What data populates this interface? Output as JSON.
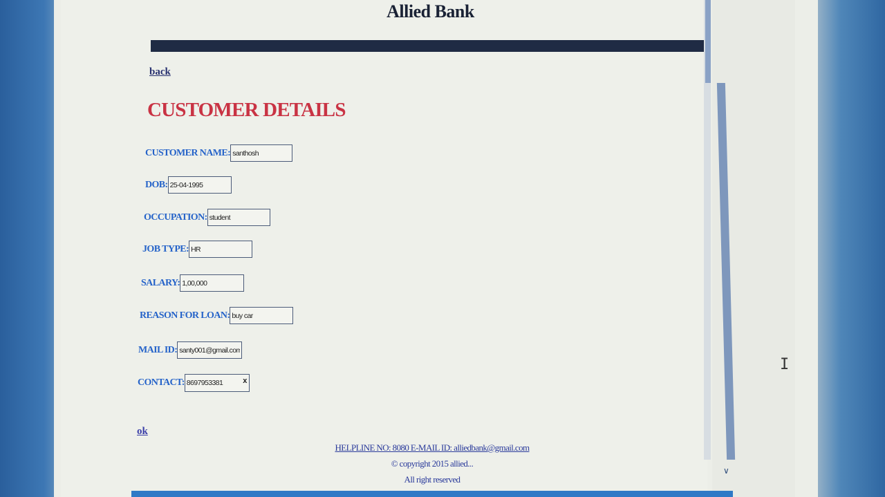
{
  "header": {
    "title": "Allied Bank"
  },
  "nav": {
    "back_label": "back",
    "ok_label": "ok"
  },
  "page": {
    "title": "CUSTOMER DETAILS"
  },
  "fields": [
    {
      "label": "CUSTOMER NAME:",
      "value": "santhosh"
    },
    {
      "label": "DOB:",
      "value": "25-04-1995"
    },
    {
      "label": "OCCUPATION:",
      "value": "student"
    },
    {
      "label": "JOB TYPE:",
      "value": "HR"
    },
    {
      "label": "SALARY:",
      "value": "1,00,000"
    },
    {
      "label": "REASON FOR LOAN:",
      "value": "buy car"
    },
    {
      "label": "MAIL ID:",
      "value": "santy001@gmail.com"
    },
    {
      "label": "CONTACT:",
      "value": "8697953381",
      "clear_glyph": "x"
    }
  ],
  "footer": {
    "helpline": "HELPLINE NO: 8080 E-MAIL ID: alliedbank@gmail.com",
    "copyright": "© copyright 2015 allied...",
    "rights": "All right reserved"
  },
  "icons": {
    "scroll_down": "chevron-down-icon",
    "cursor": "text-cursor-icon"
  },
  "colors": {
    "page_title": "#c93344",
    "field_label": "#2563c9",
    "header_bar": "#1f2b44",
    "link": "#27306f"
  }
}
